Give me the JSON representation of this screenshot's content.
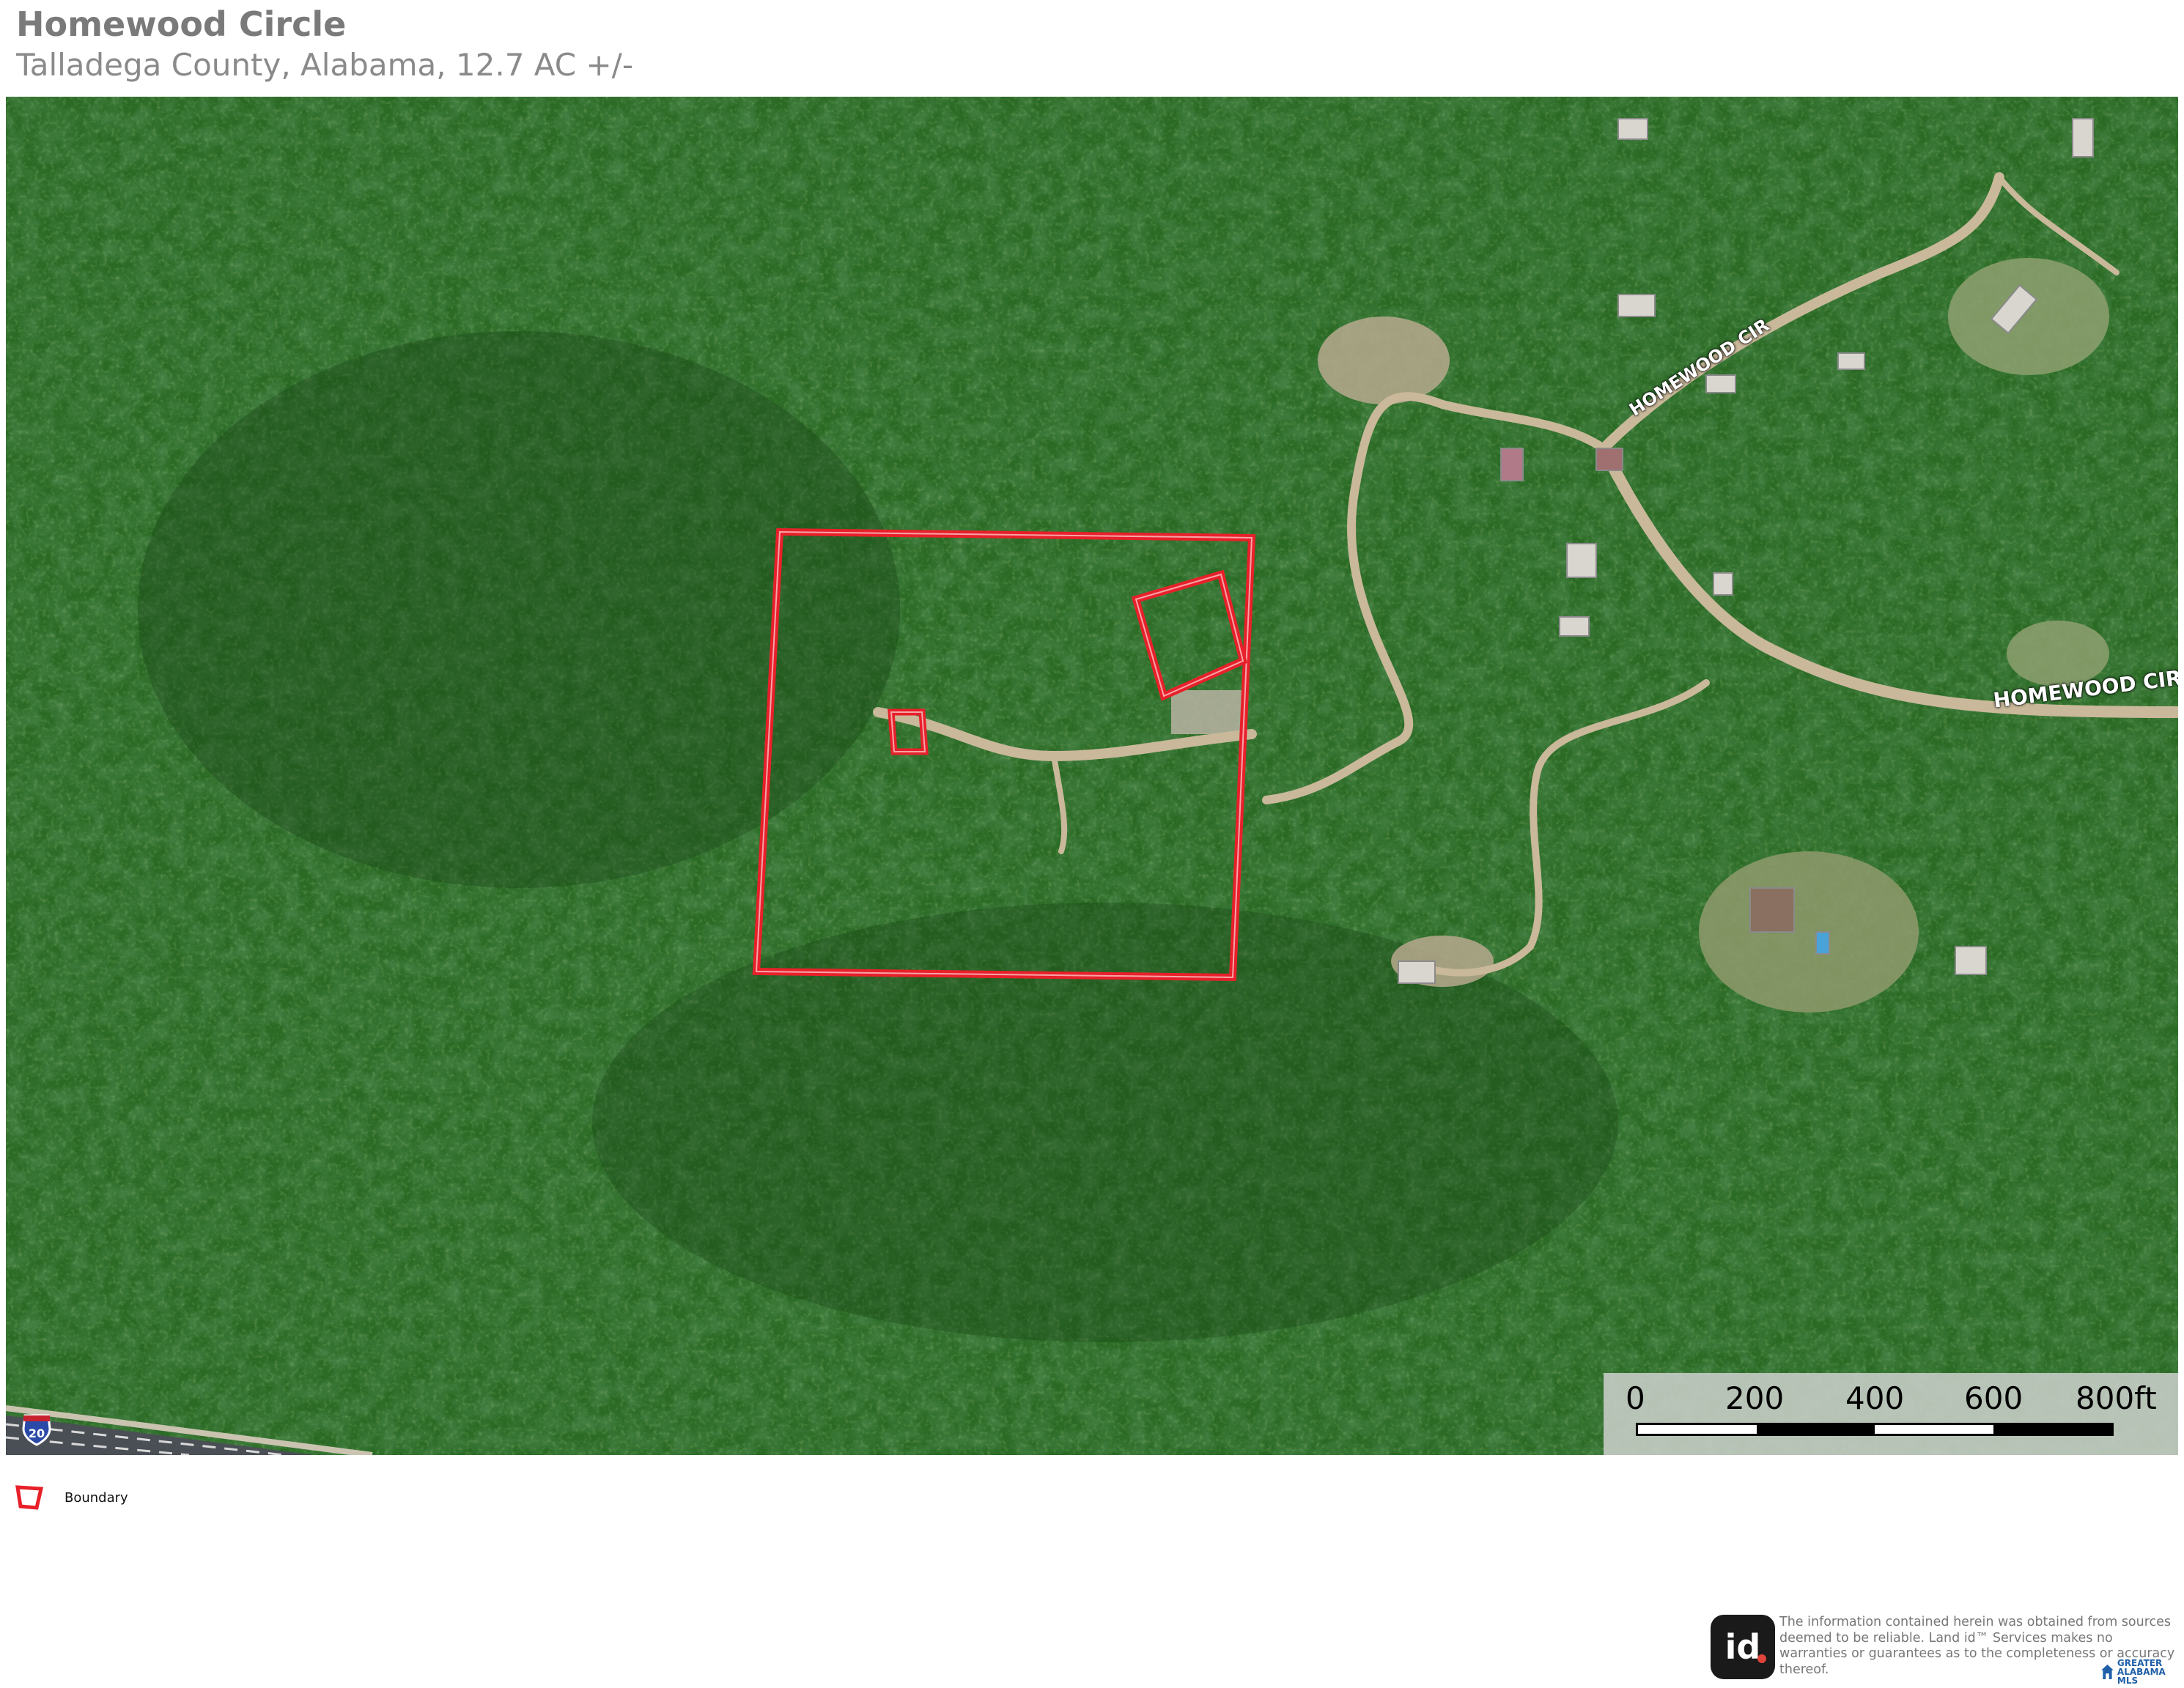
{
  "header": {
    "title": "Homewood Circle",
    "subtitle": "Talladega County, Alabama, 12.7 AC +/-"
  },
  "map": {
    "type": "satellite-imagery",
    "road_labels": [
      "HOMEWOOD CIR",
      "HOMEWOOD CIR"
    ],
    "highway_shield": "20",
    "boundary_color": "#e8202a",
    "scale_bar": {
      "ticks": [
        "0",
        "200",
        "400",
        "600",
        "800ft"
      ]
    }
  },
  "legend": {
    "items": [
      {
        "label": "Boundary",
        "icon": "boundary-polygon-icon",
        "color": "#e8202a"
      }
    ]
  },
  "footer": {
    "logo_text": "id",
    "disclaimer": "The information contained herein was obtained from sources deemed to be reliable. Land id™ Services makes no warranties or guarantees as to the completeness or accuracy thereof.",
    "mls_logo": "GREATER ALABAMA MLS"
  }
}
